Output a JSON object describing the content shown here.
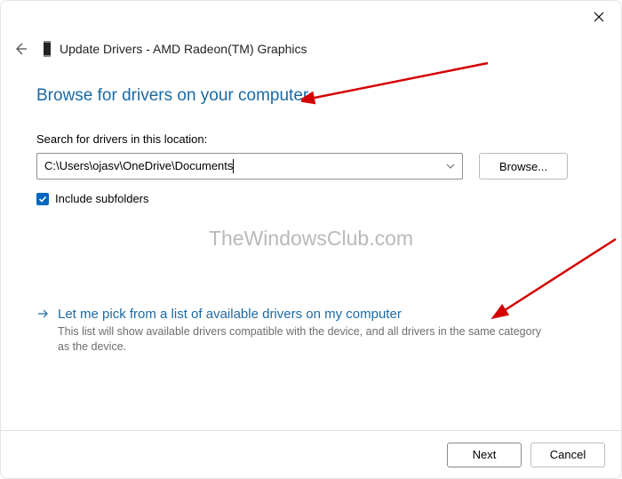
{
  "window": {
    "title": "Update Drivers - AMD Radeon(TM) Graphics"
  },
  "heading": "Browse for drivers on your computer",
  "search": {
    "label": "Search for drivers in this location:",
    "path_value": "C:\\Users\\ojasv\\OneDrive\\Documents",
    "browse_label": "Browse..."
  },
  "include_subfolders": {
    "label": "Include subfolders",
    "checked": true
  },
  "watermark": "TheWindowsClub.com",
  "pick_option": {
    "title": "Let me pick from a list of available drivers on my computer",
    "description": "This list will show available drivers compatible with the device, and all drivers in the same category as the device."
  },
  "footer": {
    "next": "Next",
    "cancel": "Cancel"
  }
}
